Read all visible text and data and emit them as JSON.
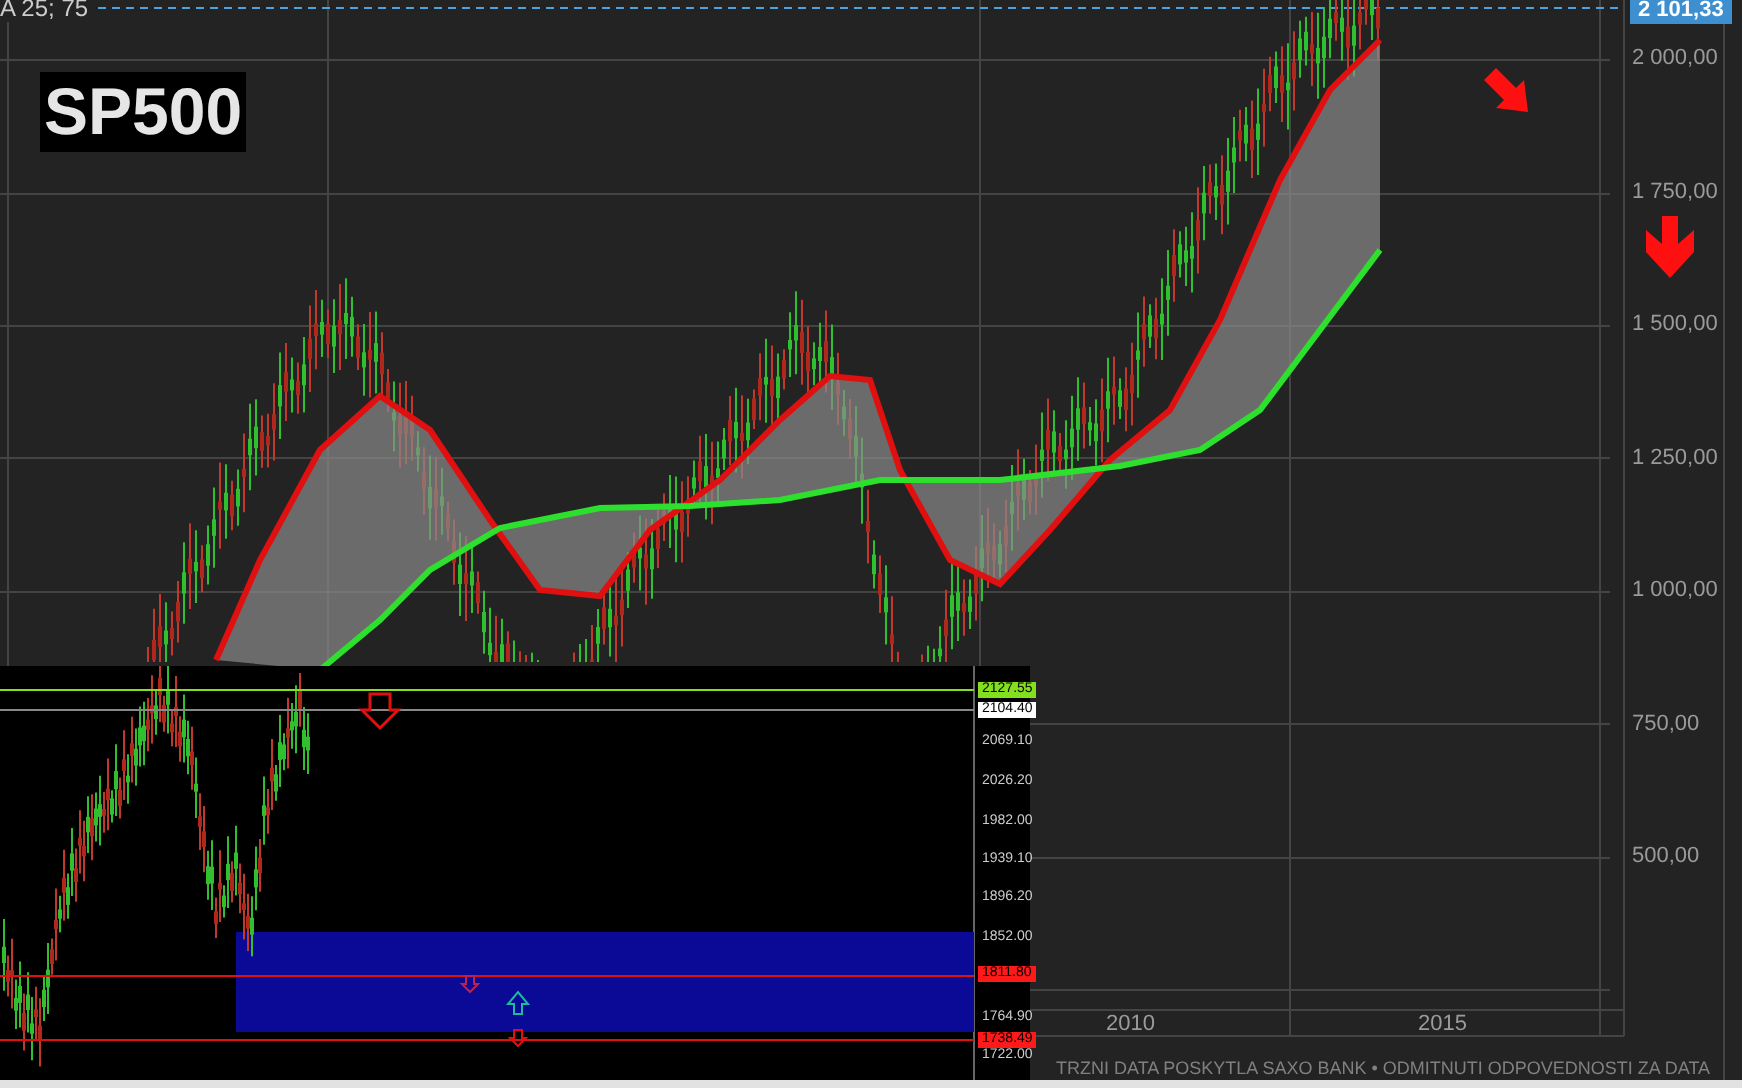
{
  "title": "SP500",
  "indicator_label": "A 25; 75",
  "price_tag": "2 101,33",
  "y_axis_labels": [
    "2 000,00",
    "1 750,00",
    "1 500,00",
    "1 250,00",
    "1 000,00",
    "750,00",
    "500,00"
  ],
  "x_axis_labels": [
    "2010",
    "2015"
  ],
  "footer": "TRZNI DATA POSKYTLA SAXO BANK • ODMITNUTI ODPOVEDNOSTI ZA DATA",
  "inset": {
    "axis_labels": [
      {
        "text": "2127.55",
        "kind": "tag",
        "color": "#84e01e"
      },
      {
        "text": "2104.40",
        "kind": "tag",
        "color": "#ffffff"
      },
      {
        "text": "2069.10",
        "kind": "tick"
      },
      {
        "text": "2026.20",
        "kind": "tick"
      },
      {
        "text": "1982.00",
        "kind": "tick"
      },
      {
        "text": "1939.10",
        "kind": "tick"
      },
      {
        "text": "1896.20",
        "kind": "tick"
      },
      {
        "text": "1852.00",
        "kind": "tick"
      },
      {
        "text": "1811.80",
        "kind": "tag",
        "color": "#ff1a1a"
      },
      {
        "text": "1764.90",
        "kind": "tick"
      },
      {
        "text": "1738.49",
        "kind": "tag",
        "color": "#ff1a1a"
      },
      {
        "text": "1722.00",
        "kind": "tick"
      }
    ]
  }
}
